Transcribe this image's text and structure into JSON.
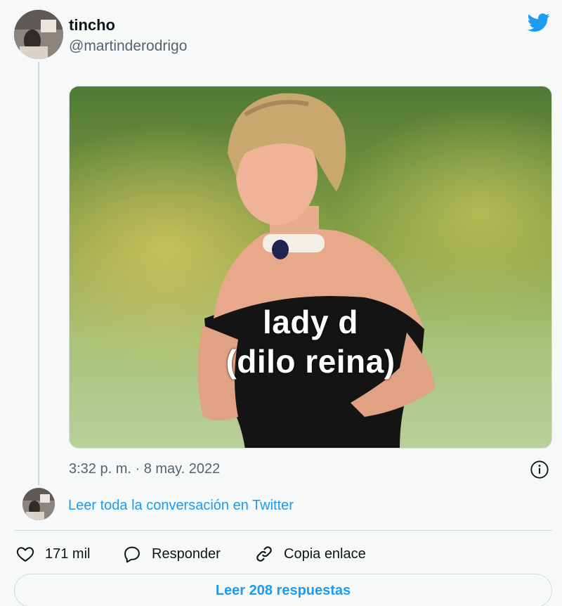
{
  "author": {
    "display_name": "tincho",
    "handle": "@martinderodrigo",
    "avatar_icon": "avatar-photo"
  },
  "brand_icon": "twitter-bird-icon",
  "media": {
    "caption_line1": "lady d",
    "caption_line2": "(dilo reina)"
  },
  "timestamp": "3:32 p. m. · 8 may. 2022",
  "info_icon": "info-icon",
  "read_conversation_label": "Leer toda la conversación en Twitter",
  "actions": {
    "like_count": "171 mil",
    "reply_label": "Responder",
    "copy_label": "Copia enlace"
  },
  "replies_button_label": "Leer 208 respuestas",
  "colors": {
    "accent": "#1d9bf0",
    "text_primary": "#0f1419",
    "text_secondary": "#536471",
    "border": "#cfd9de",
    "background": "#f7f9f9"
  }
}
